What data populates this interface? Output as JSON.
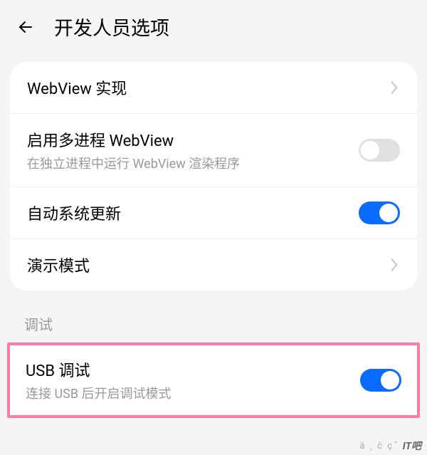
{
  "header": {
    "title": "开发人员选项"
  },
  "rows": {
    "webview_impl": {
      "title": "WebView 实现"
    },
    "multiprocess_webview": {
      "title": "启用多进程 WebView",
      "desc": "在独立进程中运行 WebView 渲染程序"
    },
    "auto_update": {
      "title": "自动系统更新"
    },
    "demo_mode": {
      "title": "演示模式"
    },
    "usb_debug": {
      "title": "USB 调试",
      "desc": "连接 USB 后开启调试模式"
    }
  },
  "sections": {
    "debug_label": "调试"
  },
  "watermark": {
    "text": "ä ¸ č   ç˝ ",
    "logo": "IT吧"
  }
}
